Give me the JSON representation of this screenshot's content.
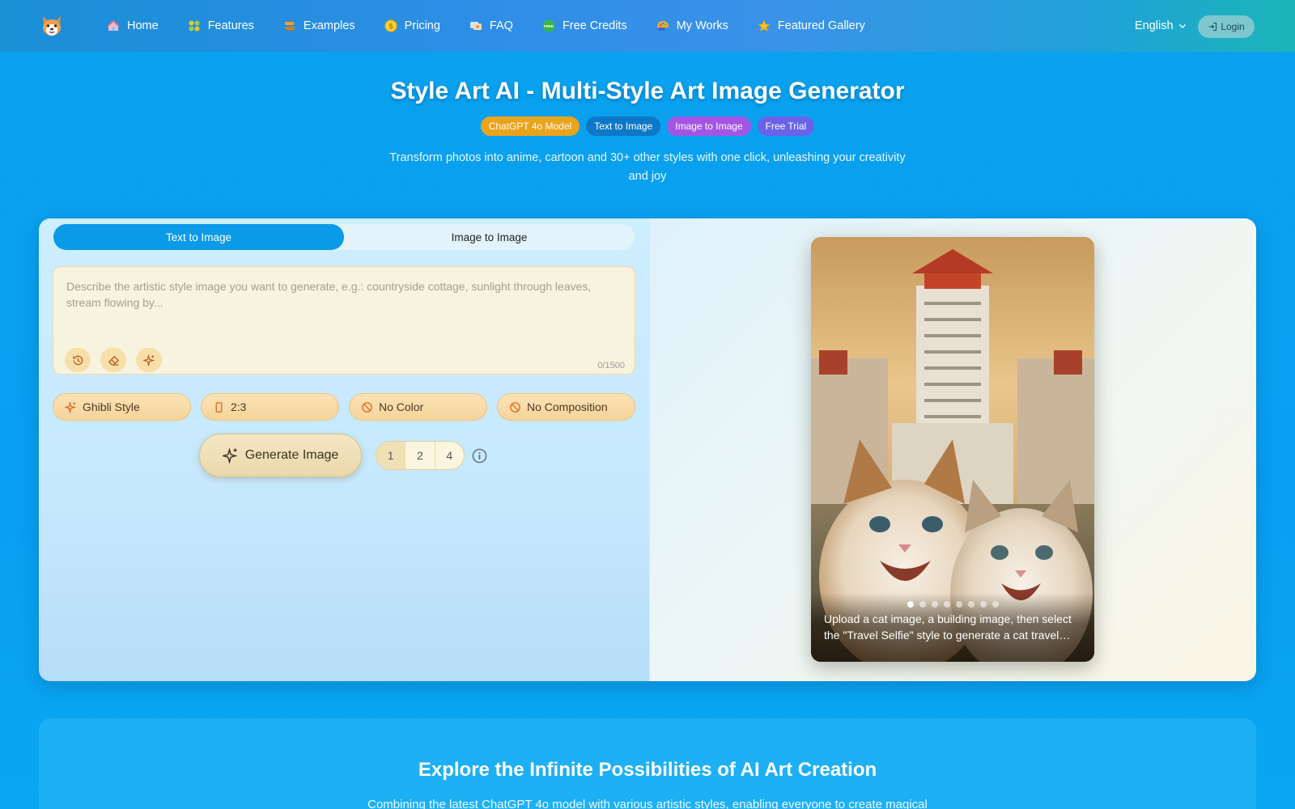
{
  "nav": {
    "items": [
      {
        "label": "Home",
        "icon": "home-icon"
      },
      {
        "label": "Features",
        "icon": "features-icon"
      },
      {
        "label": "Examples",
        "icon": "signpost-icon"
      },
      {
        "label": "Pricing",
        "icon": "coin-icon"
      },
      {
        "label": "FAQ",
        "icon": "faq-icon"
      },
      {
        "label": "Free Credits",
        "icon": "free-icon"
      },
      {
        "label": "My Works",
        "icon": "palette-icon"
      },
      {
        "label": "Featured Gallery",
        "icon": "star-icon"
      }
    ],
    "free_badge": "FREE",
    "language": "English",
    "login": "Login"
  },
  "hero": {
    "title": "Style Art AI - Multi-Style Art Image Generator",
    "badges": [
      "ChatGPT 4o Model",
      "Text to Image",
      "Image to Image",
      "Free Trial"
    ],
    "subtitle": "Transform photos into anime, cartoon and 30+ other styles with one click, unleashing your creativity and joy"
  },
  "generator": {
    "tabs": [
      "Text to Image",
      "Image to Image"
    ],
    "active_tab": 0,
    "prompt": {
      "value": "",
      "placeholder": "Describe the artistic style image you want to generate, e.g.: countryside cottage, sunlight through leaves, stream flowing by...",
      "counter": "0/1500"
    },
    "tools": [
      "history-icon",
      "eraser-icon",
      "sparkle-icon"
    ],
    "options": {
      "style": "Ghibli Style",
      "ratio": "2:3",
      "color": "No Color",
      "composition": "No Composition"
    },
    "generate_label": "Generate Image",
    "counts": [
      "1",
      "2",
      "4"
    ],
    "active_count": 0
  },
  "preview": {
    "caption": "Upload a cat image, a building image, then select the \"Travel Selfie\" style to generate a cat travel selfie image",
    "slides": 8,
    "active_slide": 0
  },
  "section2": {
    "title": "Explore the Infinite Possibilities of AI Art Creation",
    "subtitle": "Combining the latest ChatGPT 4o model with various artistic styles, enabling everyone to create magical"
  },
  "colors": {
    "accent": "#0a9ae8",
    "badge_orange": "#eaa31b",
    "badge_blue": "#0d78c8",
    "badge_purple": "#a455e6",
    "badge_indigo": "#6a63e9"
  }
}
